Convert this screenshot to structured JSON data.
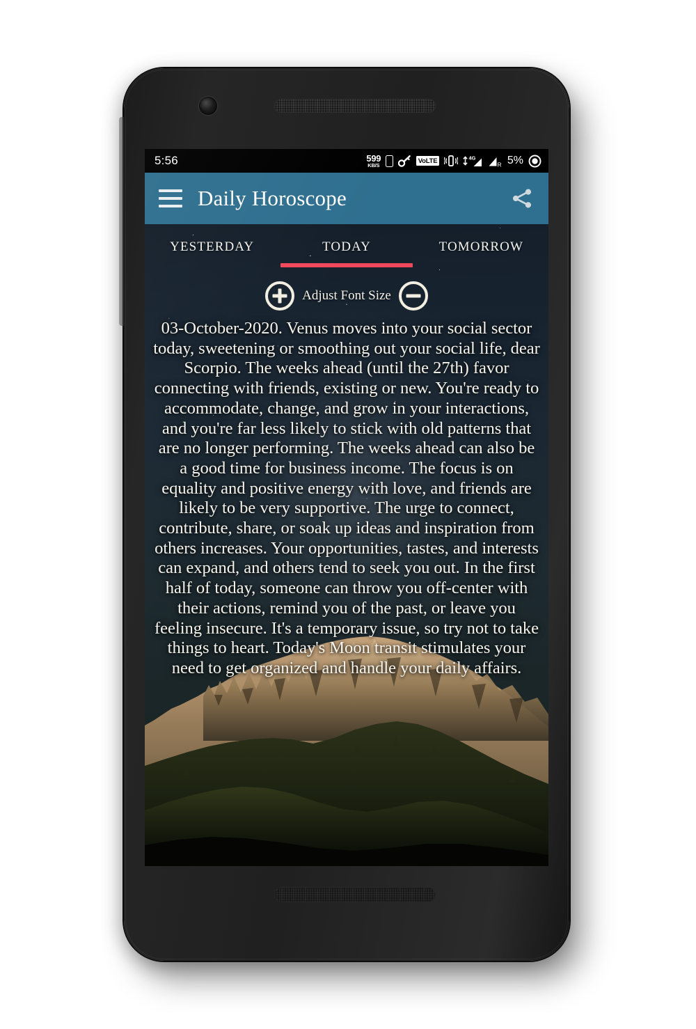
{
  "status_bar": {
    "time": "5:56",
    "network_speed_value": "599",
    "network_speed_unit": "KB/S",
    "sim_icon": "sim-card-icon",
    "vpn_icon": "vpn-key-icon",
    "volte_label": "VoLTE",
    "vibrate_icon": "vibrate-icon",
    "data_type_label": "4G",
    "roaming_label": "R",
    "battery_percent": "5%",
    "brightness_icon": "brightness-icon"
  },
  "app_bar": {
    "menu_icon": "hamburger-menu-icon",
    "title": "Daily Horoscope",
    "share_icon": "share-icon",
    "background_color": "#2f6f8f"
  },
  "tabs": {
    "indicator_color": "#f2485b",
    "items": [
      {
        "label": "YESTERDAY",
        "active": false
      },
      {
        "label": "TODAY",
        "active": true
      },
      {
        "label": "TOMORROW",
        "active": false
      }
    ]
  },
  "font_controls": {
    "increase_icon": "plus-circle-icon",
    "label": "Adjust Font Size",
    "decrease_icon": "minus-circle-icon"
  },
  "content": {
    "horoscope": "03-October-2020. Venus moves into your social sector today, sweetening or smoothing out your social life, dear Scorpio. The weeks ahead (until the 27th) favor connecting with friends, existing or new. You're ready to accommodate, change, and grow in your interactions, and you're far less likely to stick with old patterns that are no longer performing. The weeks ahead can also be a good time for business income. The focus is on equality and positive energy with love, and friends are likely to be very supportive. The urge to connect, contribute, share, or soak up ideas and inspiration from others increases. Your opportunities, tastes, and interests can expand, and others tend to seek you out. In the first half of today, someone can throw you off-center with their actions, remind you of the past, or leave you feeling insecure. It's a temporary issue, so try not to take things to heart. Today's Moon transit stimulates your need to get organized and handle your daily affairs."
  },
  "device": {
    "front_camera": "front-camera-icon",
    "earpiece": "earpiece-speaker",
    "bottom_speaker": "bottom-speaker"
  }
}
